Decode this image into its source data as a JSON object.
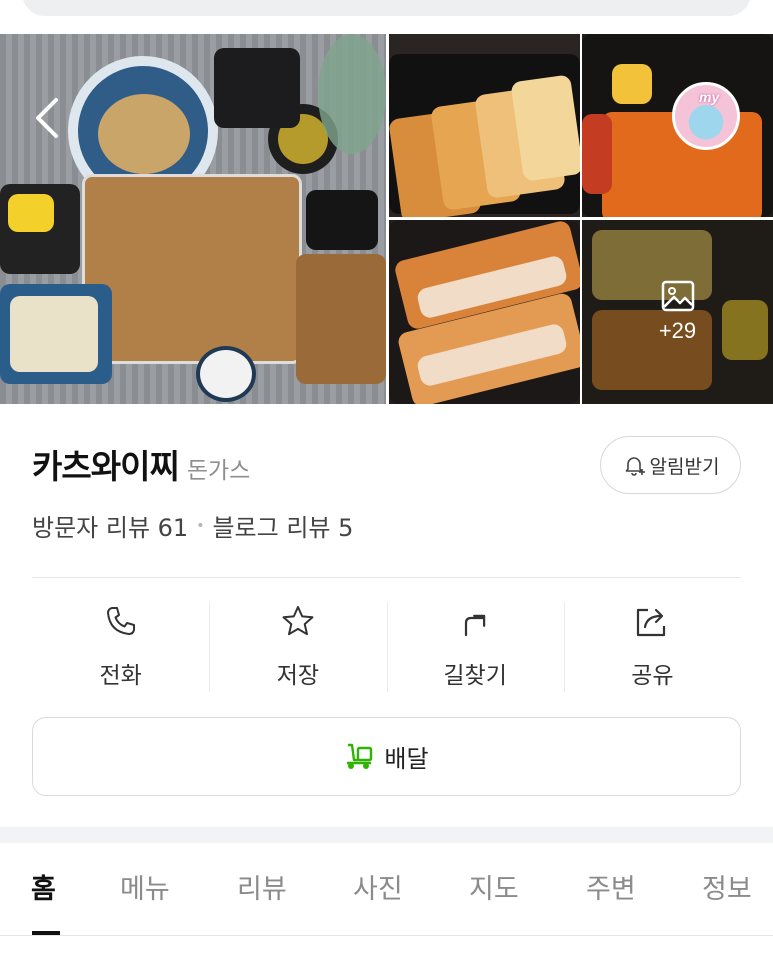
{
  "place": {
    "name": "카츠와이찌",
    "category": "돈가스"
  },
  "notify_label": "알림받기",
  "reviews": {
    "visitor": "방문자 리뷰 61",
    "separator": "•",
    "blog": "블로그 리뷰 5"
  },
  "photos": {
    "more_count": "+29",
    "avatar_text": "my"
  },
  "actions": [
    {
      "label": "전화",
      "icon": "phone-icon"
    },
    {
      "label": "저장",
      "icon": "star-icon"
    },
    {
      "label": "길찾기",
      "icon": "directions-icon"
    },
    {
      "label": "공유",
      "icon": "share-icon"
    }
  ],
  "delivery_label": "배달",
  "tabs": [
    {
      "label": "홈",
      "active": true
    },
    {
      "label": "메뉴"
    },
    {
      "label": "리뷰"
    },
    {
      "label": "사진"
    },
    {
      "label": "지도"
    },
    {
      "label": "주변"
    },
    {
      "label": "정보"
    }
  ],
  "colors": {
    "delivery_green": "#2db400",
    "text_primary": "#111111",
    "text_muted": "#8b8b8b"
  }
}
